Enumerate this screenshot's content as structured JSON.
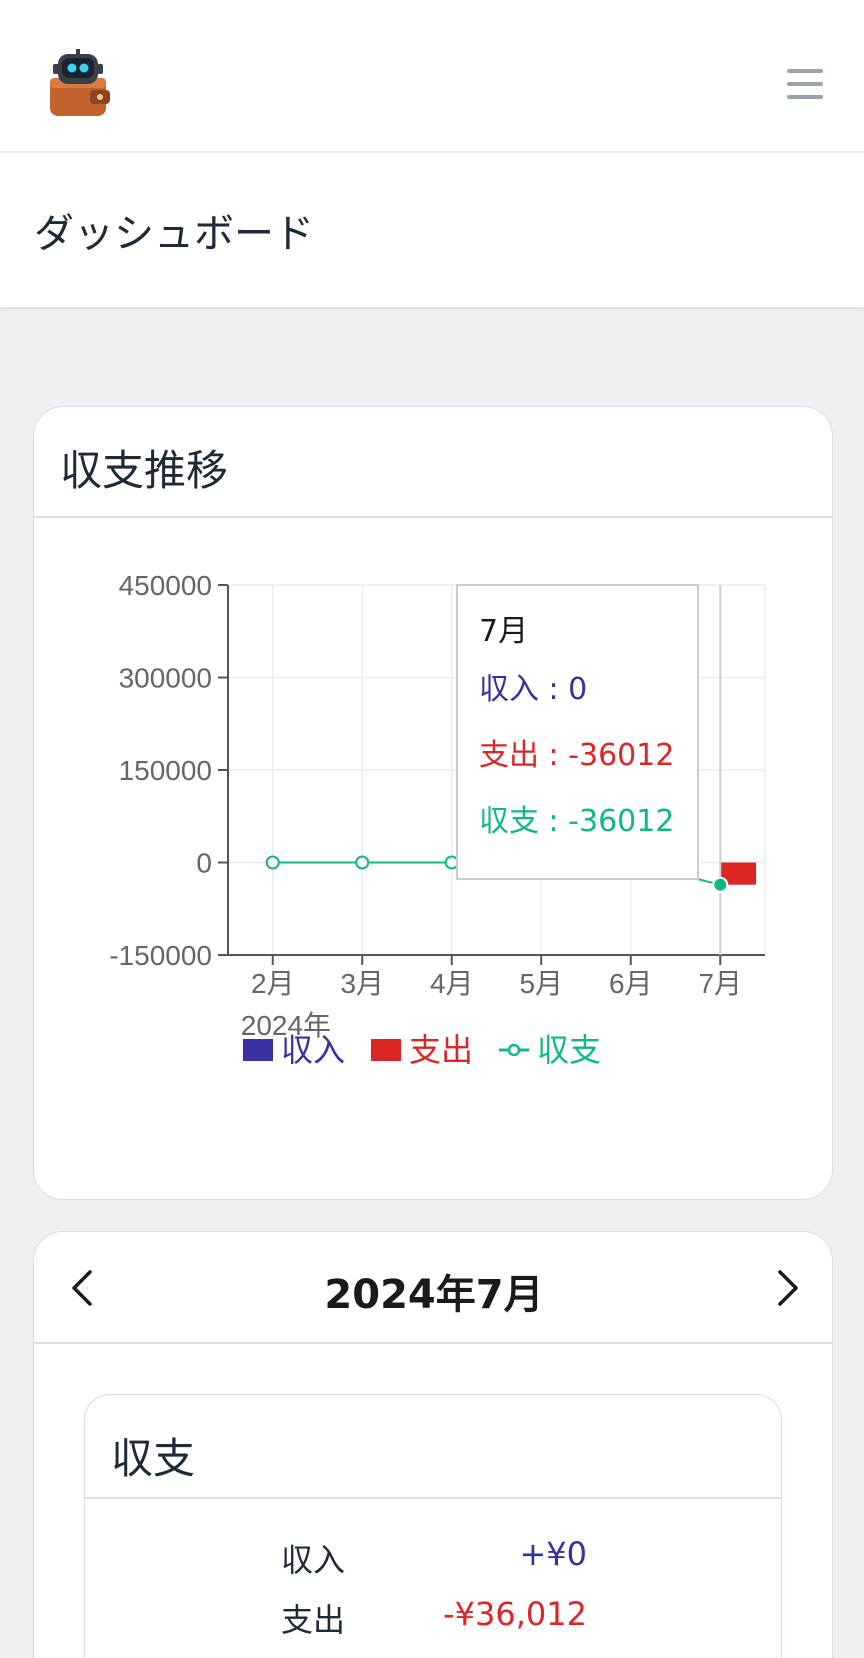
{
  "app": {
    "page_title": "ダッシュボード",
    "logo_icon": "robot-wallet-logo-icon",
    "menu_icon": "hamburger-menu-icon"
  },
  "trend_card": {
    "title": "収支推移"
  },
  "chart_data": {
    "type": "bar",
    "categories": [
      "2月",
      "3月",
      "4月",
      "5月",
      "6月",
      "7月"
    ],
    "x_sublabel": "2024年",
    "ylim": [
      -150000,
      450000
    ],
    "yticks": [
      450000,
      300000,
      150000,
      0,
      -150000
    ],
    "ytick_labels": [
      "450000",
      "300000",
      "150000",
      "0",
      "-150000"
    ],
    "grid": true,
    "legend_position": "bottom",
    "series": [
      {
        "name": "収入",
        "kind": "bar",
        "color": "#3730a3",
        "values": [
          0,
          0,
          0,
          0,
          0,
          0
        ]
      },
      {
        "name": "支出",
        "kind": "bar",
        "color": "#dc2626",
        "values": [
          0,
          0,
          0,
          0,
          0,
          -36012
        ]
      },
      {
        "name": "収支",
        "kind": "line",
        "color": "#10b981",
        "values": [
          0,
          0,
          0,
          0,
          0,
          -36012
        ]
      }
    ],
    "tooltip": {
      "title": "7月",
      "lines": [
        {
          "text": "収入 : 0",
          "color": "#3730a3"
        },
        {
          "text": "支出 : -36012",
          "color": "#dc2626"
        },
        {
          "text": "収支 : -36012",
          "color": "#10b981"
        }
      ]
    }
  },
  "monthly_card": {
    "month_label": "2024年7月",
    "prev_icon": "chevron-left-icon",
    "next_icon": "chevron-right-icon",
    "summary": {
      "title": "収支",
      "rows": [
        {
          "label": "収入",
          "value": "+¥0",
          "color": "#3730a3"
        },
        {
          "label": "支出",
          "value": "-¥36,012",
          "color": "#dc2626"
        }
      ]
    }
  }
}
